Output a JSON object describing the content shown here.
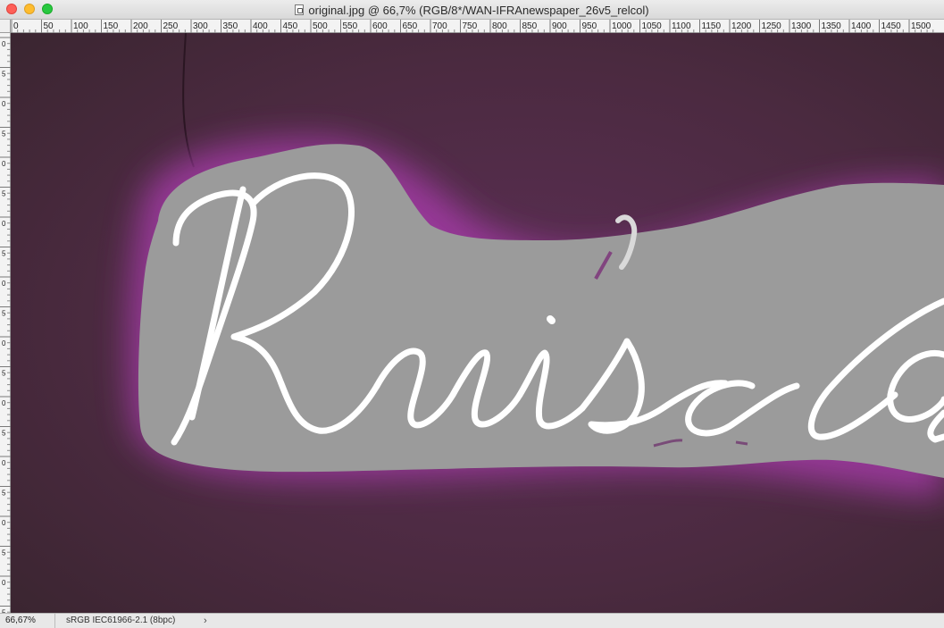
{
  "window": {
    "title": "original.jpg @ 66,7% (RGB/8*/WAN-IFRAnewspaper_26v5_relcol)"
  },
  "ruler": {
    "top_labels": [
      "0",
      "50",
      "100",
      "150",
      "200",
      "250",
      "300",
      "350",
      "400",
      "450",
      "500",
      "550",
      "600",
      "650",
      "700",
      "750",
      "800",
      "850",
      "900",
      "950",
      "1000",
      "1050",
      "1100",
      "1150",
      "1200",
      "1250",
      "1300",
      "1350",
      "1400",
      "1450",
      "1500"
    ],
    "left_labels": [
      "0",
      "5",
      "0",
      "5",
      "0",
      "5",
      "0",
      "5",
      "0",
      "5",
      "0",
      "5",
      "0",
      "5",
      "0",
      "5",
      "0",
      "5",
      "0",
      "5"
    ]
  },
  "canvas": {
    "sign_text": "Ruisda",
    "colors": {
      "wall": "#4a2a3e",
      "glow": "#a23aa4",
      "plate": "#9b9b9b",
      "neon": "#ffffff"
    }
  },
  "status": {
    "zoom": "66,67%",
    "profile": "sRGB IEC61966-2.1 (8bpc)",
    "arrow": "›"
  }
}
